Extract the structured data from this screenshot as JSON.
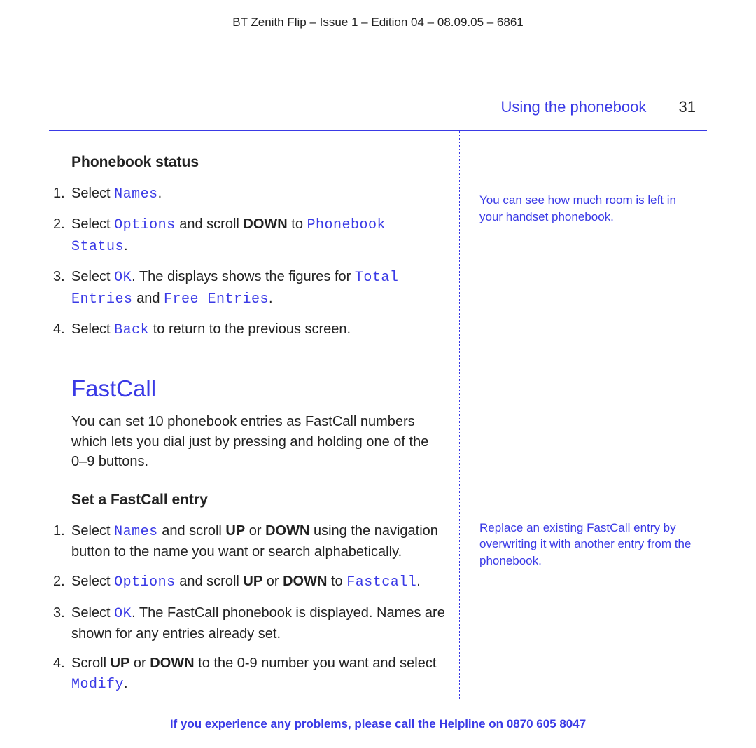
{
  "doc_header": "BT Zenith Flip – Issue 1 – Edition 04 – 08.09.05 – 6861",
  "page_header": {
    "section": "Using the phonebook",
    "number": "31"
  },
  "phonebook_status": {
    "heading": "Phonebook status",
    "steps": {
      "s1_a": "Select ",
      "s1_lcd": "Names",
      "s1_c": ".",
      "s2_a": "Select ",
      "s2_lcd1": "Options",
      "s2_b": " and scroll ",
      "s2_bold": "DOWN",
      "s2_c": " to ",
      "s2_lcd2": "Phonebook Status",
      "s2_d": ".",
      "s3_a": "Select ",
      "s3_lcd1": "OK",
      "s3_b": ". The displays shows the figures for ",
      "s3_lcd2": "Total Entries",
      "s3_c": " and ",
      "s3_lcd3": "Free Entries",
      "s3_d": ".",
      "s4_a": "Select ",
      "s4_lcd": "Back",
      "s4_b": " to return to the previous screen."
    },
    "side_note": "You can see how much room is left in your handset phonebook."
  },
  "fastcall": {
    "heading": "FastCall",
    "intro": "You can set 10 phonebook entries as FastCall numbers which lets you dial just by pressing and holding one of the 0–9 buttons.",
    "set_heading": "Set a FastCall entry",
    "steps": {
      "s1_a": "Select ",
      "s1_lcd": "Names",
      "s1_b": " and scroll ",
      "s1_bold1": "UP",
      "s1_c": " or ",
      "s1_bold2": "DOWN",
      "s1_d": " using the navigation button to the name you want or search alphabetically.",
      "s2_a": "Select ",
      "s2_lcd1": "Options",
      "s2_b": " and scroll ",
      "s2_bold1": "UP",
      "s2_c": " or ",
      "s2_bold2": "DOWN",
      "s2_d": " to ",
      "s2_lcd2": "Fastcall",
      "s2_e": ".",
      "s3_a": "Select ",
      "s3_lcd": "OK",
      "s3_b": ". The FastCall phonebook is displayed. Names are shown for any entries already set.",
      "s4_a": "Scroll ",
      "s4_bold1": "UP",
      "s4_b": " or ",
      "s4_bold2": "DOWN",
      "s4_c": " to the 0-9 number you want and select ",
      "s4_lcd": "Modify",
      "s4_d": "."
    },
    "side_note": "Replace an existing FastCall entry by overwriting it with another entry from the phonebook."
  },
  "footer": {
    "text_a": "If you experience any problems, please call the Helpline on ",
    "number": "0870 605 8047"
  }
}
